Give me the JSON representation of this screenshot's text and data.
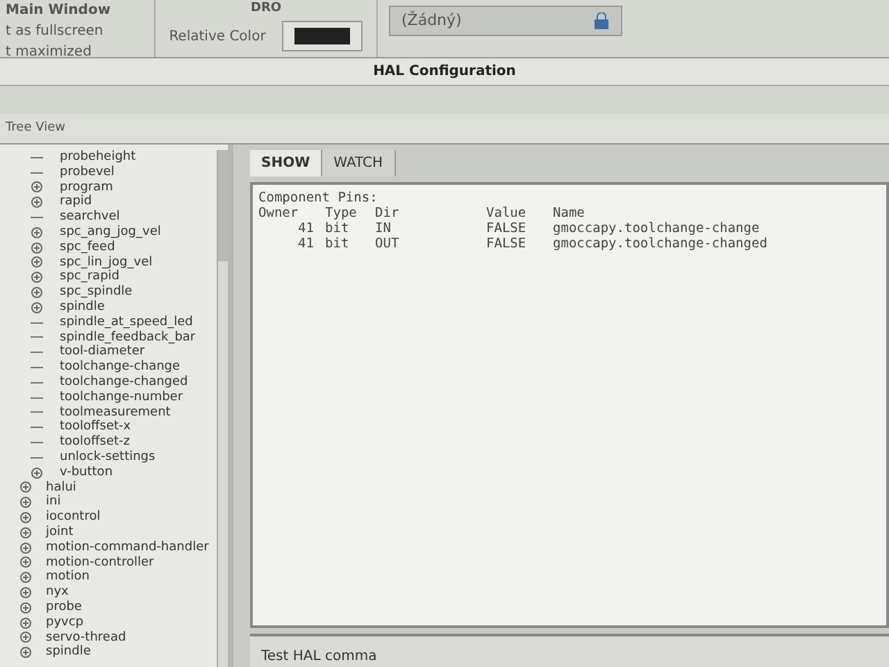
{
  "background_window": {
    "group_title": "Main Window",
    "options": [
      "t as fullscreen",
      "t maximized"
    ],
    "dro_title": "DRO",
    "relative_color_label": "Relative Color",
    "combo_value": "(Žádný)"
  },
  "window": {
    "title": "HAL Configuration"
  },
  "tree_view": {
    "label": "Tree View",
    "items": [
      {
        "children": [
          {
            "label": "probeheight",
            "expandable": false
          },
          {
            "label": "probevel",
            "expandable": false
          },
          {
            "label": "program",
            "expandable": true
          },
          {
            "label": "rapid",
            "expandable": true
          },
          {
            "label": "searchvel",
            "expandable": false
          },
          {
            "label": "spc_ang_jog_vel",
            "expandable": true
          },
          {
            "label": "spc_feed",
            "expandable": true
          },
          {
            "label": "spc_lin_jog_vel",
            "expandable": true
          },
          {
            "label": "spc_rapid",
            "expandable": true
          },
          {
            "label": "spc_spindle",
            "expandable": true
          },
          {
            "label": "spindle",
            "expandable": true
          },
          {
            "label": "spindle_at_speed_led",
            "expandable": false
          },
          {
            "label": "spindle_feedback_bar",
            "expandable": false
          },
          {
            "label": "tool-diameter",
            "expandable": false
          },
          {
            "label": "toolchange-change",
            "expandable": false
          },
          {
            "label": "toolchange-changed",
            "expandable": false
          },
          {
            "label": "toolchange-number",
            "expandable": false
          },
          {
            "label": "toolmeasurement",
            "expandable": false
          },
          {
            "label": "tooloffset-x",
            "expandable": false
          },
          {
            "label": "tooloffset-z",
            "expandable": false
          },
          {
            "label": "unlock-settings",
            "expandable": false
          },
          {
            "label": "v-button",
            "expandable": true
          }
        ]
      },
      {
        "label": "halui",
        "expandable": true
      },
      {
        "label": "ini",
        "expandable": true
      },
      {
        "label": "iocontrol",
        "expandable": true
      },
      {
        "label": "joint",
        "expandable": true
      },
      {
        "label": "motion-command-handler",
        "expandable": true
      },
      {
        "label": "motion-controller",
        "expandable": true
      },
      {
        "label": "motion",
        "expandable": true
      },
      {
        "label": "nyx",
        "expandable": true
      },
      {
        "label": "probe",
        "expandable": true
      },
      {
        "label": "pyvcp",
        "expandable": true
      },
      {
        "label": "servo-thread",
        "expandable": true
      },
      {
        "label": "spindle",
        "expandable": true
      }
    ]
  },
  "tabs": [
    {
      "label": "SHOW",
      "selected": true
    },
    {
      "label": "WATCH",
      "selected": false
    }
  ],
  "output": {
    "heading": "Component Pins:",
    "columns": [
      "Owner",
      "Type",
      "Dir",
      "Value",
      "Name"
    ],
    "rows": [
      [
        "41",
        "bit",
        "IN",
        "FALSE",
        "gmoccapy.toolchange-change"
      ],
      [
        "41",
        "bit",
        "OUT",
        "FALSE",
        "gmoccapy.toolchange-changed"
      ]
    ]
  },
  "command": {
    "label": "Test HAL comma"
  }
}
